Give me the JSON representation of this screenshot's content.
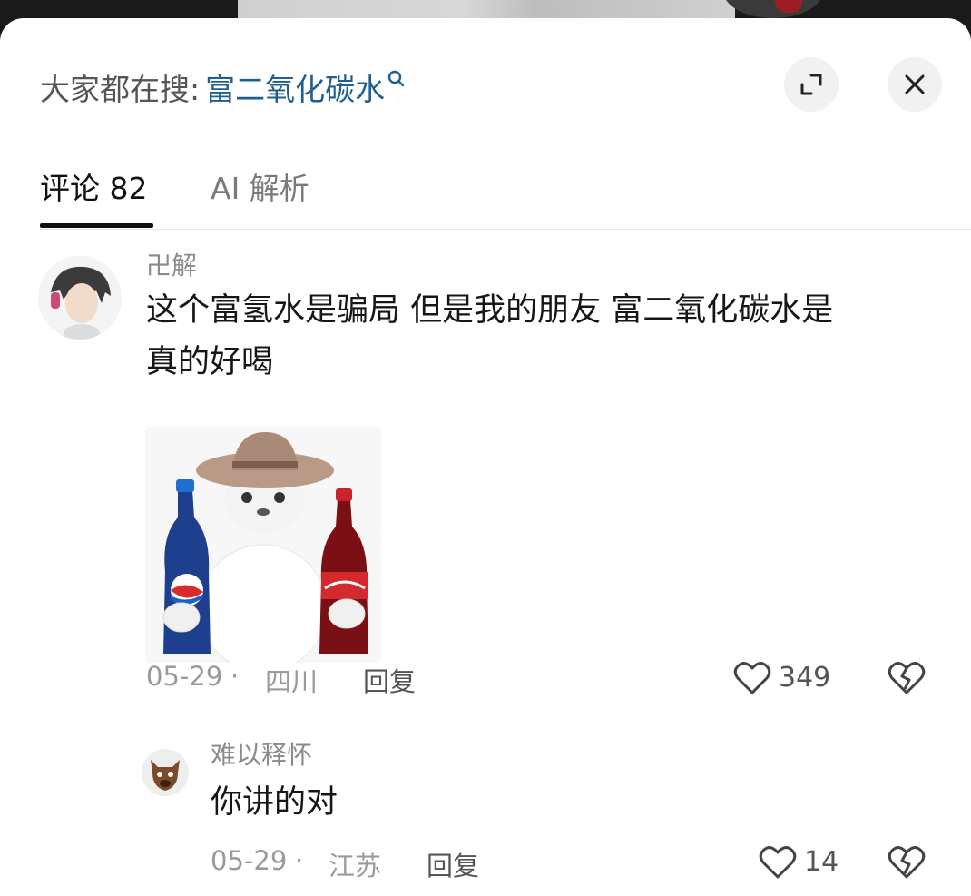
{
  "search": {
    "prefix": "大家都在搜:",
    "term": "富二氧化碳水",
    "icon": "search-icon"
  },
  "controls": {
    "expand_icon": "expand-icon",
    "close_icon": "close-icon"
  },
  "tabs": [
    {
      "label": "评论 82",
      "active": true
    },
    {
      "label": "AI 解析",
      "active": false
    }
  ],
  "comments": [
    {
      "username": "卍解",
      "lines": [
        "这个富氢水是骗局 但是我的朋友 富二氧化碳水是",
        "真的好喝"
      ],
      "sticker": "cat-with-cola-sticker",
      "date": "05-29",
      "location": "四川",
      "reply_label": "回复",
      "likes": "349",
      "replies": [
        {
          "username": "难以释怀",
          "text": "你讲的对",
          "date": "05-29",
          "location": "江苏",
          "reply_label": "回复",
          "likes": "14"
        }
      ]
    }
  ],
  "colors": {
    "accent_search": "#1f5f8f",
    "text_primary": "#161616",
    "text_secondary": "#8a8a8a"
  }
}
